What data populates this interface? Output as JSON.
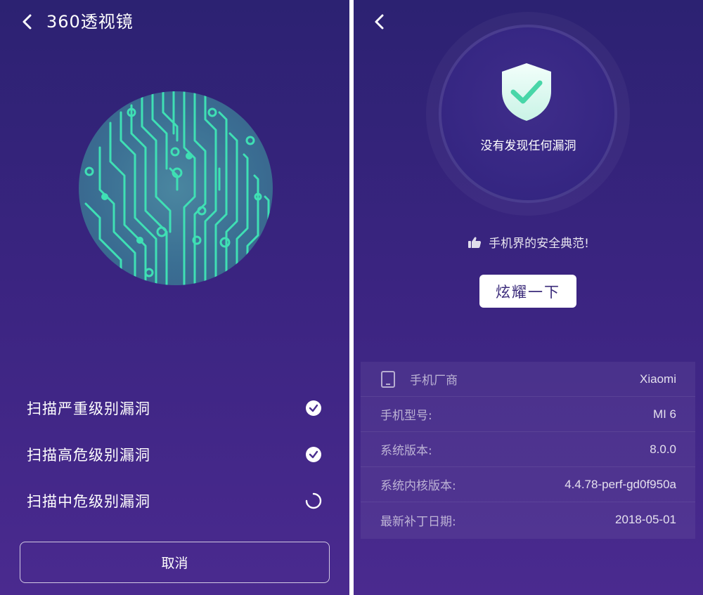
{
  "left": {
    "title": "360透视镜",
    "scan_items": [
      {
        "label": "扫描严重级别漏洞",
        "status": "done"
      },
      {
        "label": "扫描高危级别漏洞",
        "status": "done"
      },
      {
        "label": "扫描中危级别漏洞",
        "status": "in-progress"
      }
    ],
    "cancel_label": "取消"
  },
  "right": {
    "result_text": "没有发现任何漏洞",
    "praise_text": "手机界的安全典范!",
    "show_button_label": "炫耀一下",
    "info": [
      {
        "label": "手机厂商",
        "value": "Xiaomi",
        "icon": "phone-icon"
      },
      {
        "label": "手机型号:",
        "value": "MI 6"
      },
      {
        "label": "系统版本:",
        "value": "8.0.0"
      },
      {
        "label": "系统内核版本:",
        "value": "4.4.78-perf-gd0f950a"
      },
      {
        "label": "最新补丁日期:",
        "value": "2018-05-01"
      }
    ]
  },
  "colors": {
    "background_top": "#2c2272",
    "background_bottom": "#4a2a8f",
    "circuit_green": "#3fe0b4",
    "shield_green": "#48d6a8"
  }
}
